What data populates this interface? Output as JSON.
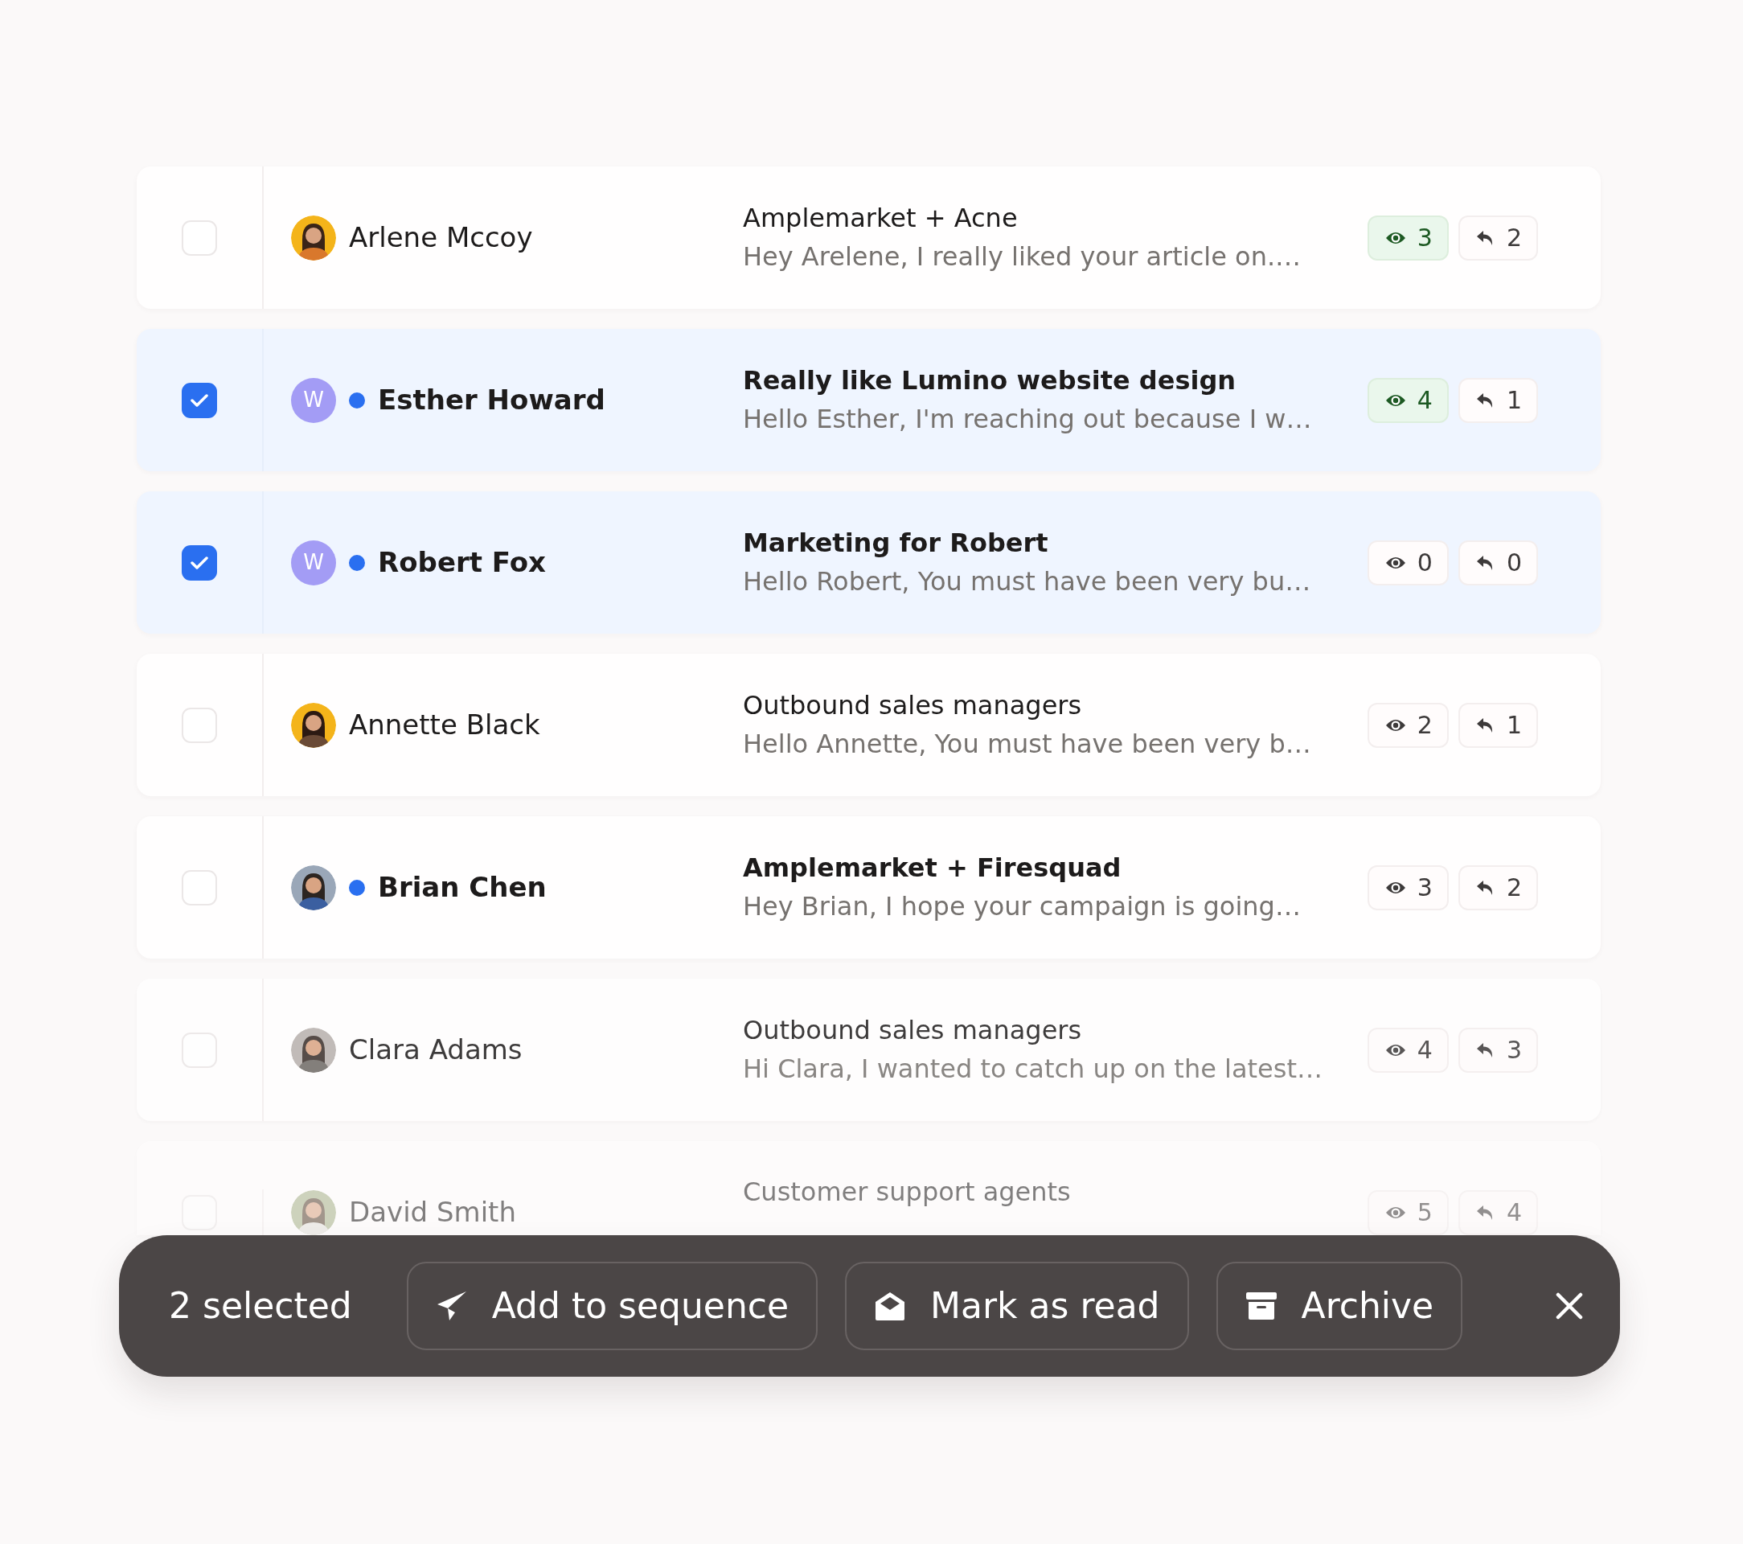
{
  "rows": [
    {
      "selected": false,
      "unread": false,
      "name": "Arlene Mccoy",
      "subject": "Amplemarket + Acne",
      "preview": "Hey Arelene, I really liked your article on.…",
      "opens": "3",
      "opens_highlighted": true,
      "replies": "2"
    },
    {
      "selected": true,
      "avatar": {
        "kind": "initial",
        "text": "W"
      },
      "unread": true,
      "name": "Esther Howard",
      "subject": "Really like Lumino website design",
      "preview": "Hello Esther, I'm reaching out because I w…",
      "opens": "4",
      "opens_highlighted": true,
      "replies": "1"
    },
    {
      "selected": true,
      "avatar": {
        "kind": "initial",
        "text": "W"
      },
      "unread": true,
      "name": "Robert Fox",
      "subject": "Marketing for Robert",
      "preview": "Hello Robert, You must have been very bu…",
      "opens": "0",
      "opens_highlighted": false,
      "replies": "0"
    },
    {
      "selected": false,
      "unread": false,
      "name": "Annette Black",
      "subject": "Outbound sales managers",
      "preview": "Hello Annette, You must have been very b…",
      "opens": "2",
      "opens_highlighted": false,
      "replies": "1"
    },
    {
      "selected": false,
      "unread": true,
      "name": "Brian Chen",
      "subject": "Amplemarket + Firesquad",
      "preview": "Hey Brian, I hope your campaign is going…",
      "opens": "3",
      "opens_highlighted": false,
      "replies": "2"
    },
    {
      "selected": false,
      "unread": false,
      "name": "Clara Adams",
      "subject": "Outbound sales managers",
      "preview": "Hi Clara, I wanted to catch up on the latest…",
      "opens": "4",
      "opens_highlighted": false,
      "replies": "3"
    },
    {
      "selected": false,
      "unread": false,
      "name": "David Smith",
      "subject": "Customer support agents",
      "opens": "5",
      "opens_highlighted": false,
      "replies": "4"
    }
  ],
  "action_bar": {
    "selected_count": "2 selected",
    "actions": [
      {
        "kind": "send",
        "label": "Add to sequence"
      },
      {
        "kind": "mark-read",
        "label": "Mark as read"
      },
      {
        "kind": "archive",
        "label": "Archive"
      }
    ]
  }
}
